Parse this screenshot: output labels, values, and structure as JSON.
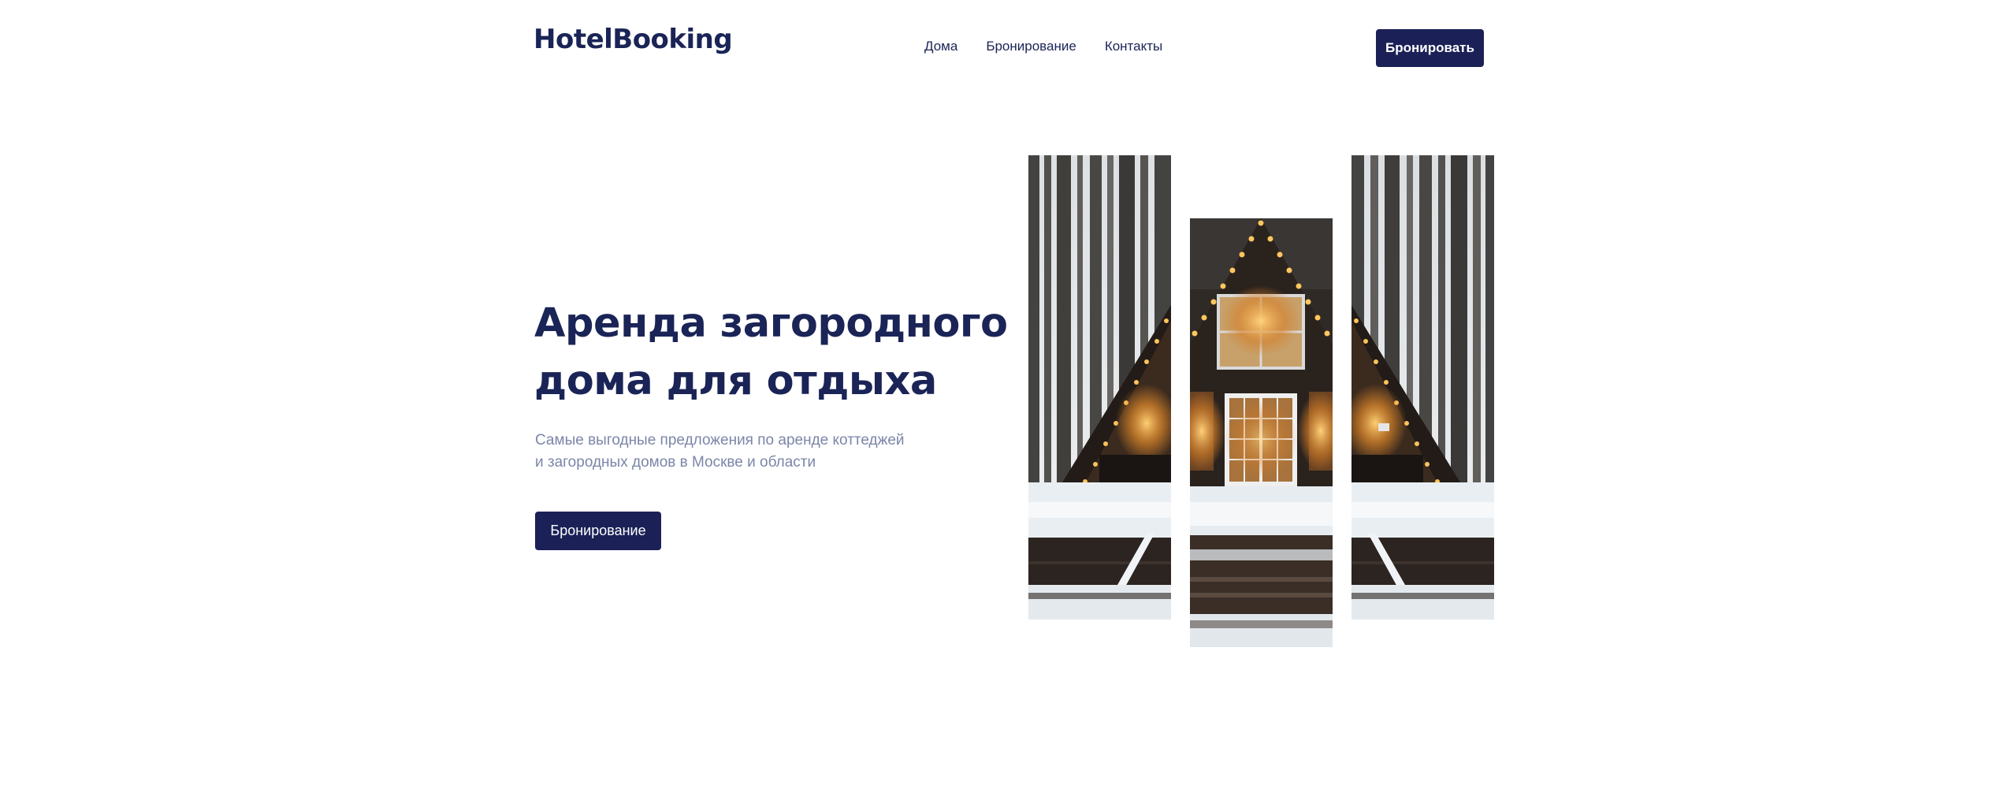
{
  "header": {
    "logo": "HotelBooking",
    "nav": [
      "Дома",
      "Бронирование",
      "Контакты"
    ],
    "cta_label": "Бронировать"
  },
  "hero": {
    "title_line1": "Аренда загородного",
    "title_line2": "дома для отдыха",
    "subtitle_line1": "Самые выгодные предложения по аренде коттеджей",
    "subtitle_line2": "и загородных домов в Москве и области",
    "button_label": "Бронирование"
  },
  "colors": {
    "brand": "#1b2157",
    "subtitle": "#7b86a8"
  }
}
